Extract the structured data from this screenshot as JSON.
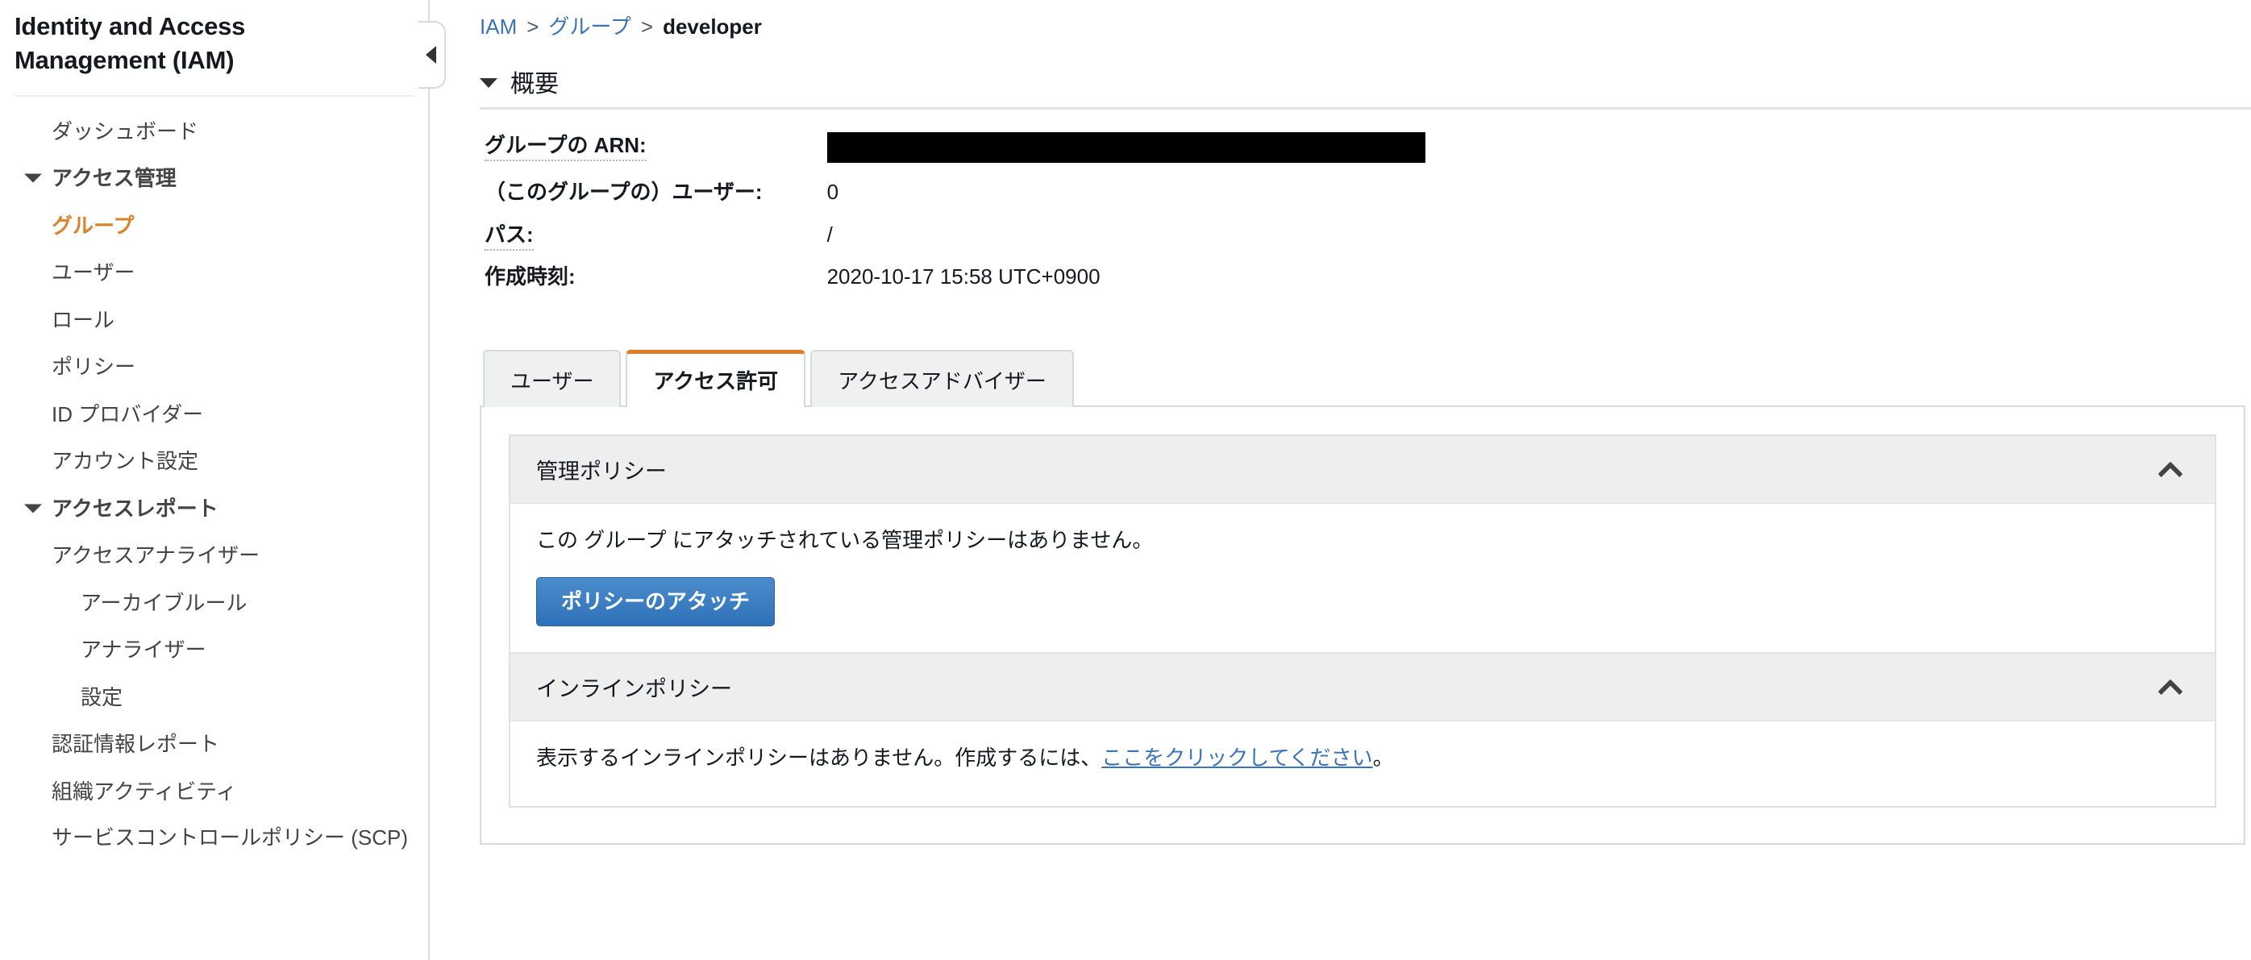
{
  "sidebar": {
    "title": "Identity and Access Management (IAM)",
    "items": [
      {
        "label": "ダッシュボード",
        "type": "link",
        "indent": 1,
        "active": false
      },
      {
        "label": "アクセス管理",
        "type": "group",
        "indent": 1,
        "active": false
      },
      {
        "label": "グループ",
        "type": "link",
        "indent": 1,
        "active": true
      },
      {
        "label": "ユーザー",
        "type": "link",
        "indent": 1,
        "active": false
      },
      {
        "label": "ロール",
        "type": "link",
        "indent": 1,
        "active": false
      },
      {
        "label": "ポリシー",
        "type": "link",
        "indent": 1,
        "active": false
      },
      {
        "label": "ID プロバイダー",
        "type": "link",
        "indent": 1,
        "active": false
      },
      {
        "label": "アカウント設定",
        "type": "link",
        "indent": 1,
        "active": false
      },
      {
        "label": "アクセスレポート",
        "type": "group",
        "indent": 1,
        "active": false
      },
      {
        "label": "アクセスアナライザー",
        "type": "link",
        "indent": 1,
        "active": false
      },
      {
        "label": "アーカイブルール",
        "type": "link",
        "indent": 2,
        "active": false
      },
      {
        "label": "アナライザー",
        "type": "link",
        "indent": 2,
        "active": false
      },
      {
        "label": "設定",
        "type": "link",
        "indent": 2,
        "active": false
      },
      {
        "label": "認証情報レポート",
        "type": "link",
        "indent": 1,
        "active": false
      },
      {
        "label": "組織アクティビティ",
        "type": "link",
        "indent": 1,
        "active": false
      },
      {
        "label": "サービスコントロールポリシー (SCP)",
        "type": "link",
        "indent": 1,
        "active": false
      }
    ],
    "collapse_icon": "caret-left-icon"
  },
  "breadcrumb": {
    "root": "IAM",
    "parent": "グループ",
    "current": "developer",
    "separator": ">"
  },
  "summary": {
    "heading": "概要",
    "rows": [
      {
        "label": "グループの ARN:",
        "value": "",
        "redacted": true,
        "dotted": true
      },
      {
        "label": "（このグループの）ユーザー:",
        "value": "0",
        "redacted": false,
        "dotted": false
      },
      {
        "label": "パス:",
        "value": "/",
        "redacted": false,
        "dotted": true
      },
      {
        "label": "作成時刻:",
        "value": "2020-10-17 15:58 UTC+0900",
        "redacted": false,
        "dotted": false
      }
    ]
  },
  "tabs": [
    {
      "label": "ユーザー",
      "active": false
    },
    {
      "label": "アクセス許可",
      "active": true
    },
    {
      "label": "アクセスアドバイザー",
      "active": false
    }
  ],
  "panels": {
    "managed": {
      "title": "管理ポリシー",
      "empty_text": "この グループ にアタッチされている管理ポリシーはありません。",
      "button_label": "ポリシーのアタッチ",
      "toggle_icon": "chevron-up-icon"
    },
    "inline": {
      "title": "インラインポリシー",
      "text_before": "表示するインラインポリシーはありません。作成するには、",
      "link_text": "ここをクリックしてください",
      "text_after": "。",
      "toggle_icon": "chevron-up-icon"
    }
  },
  "colors": {
    "accent_orange": "#d9822b",
    "tab_active_border": "#e07b27",
    "link_blue": "#3b73b9",
    "button_blue": "#2f71b8"
  }
}
